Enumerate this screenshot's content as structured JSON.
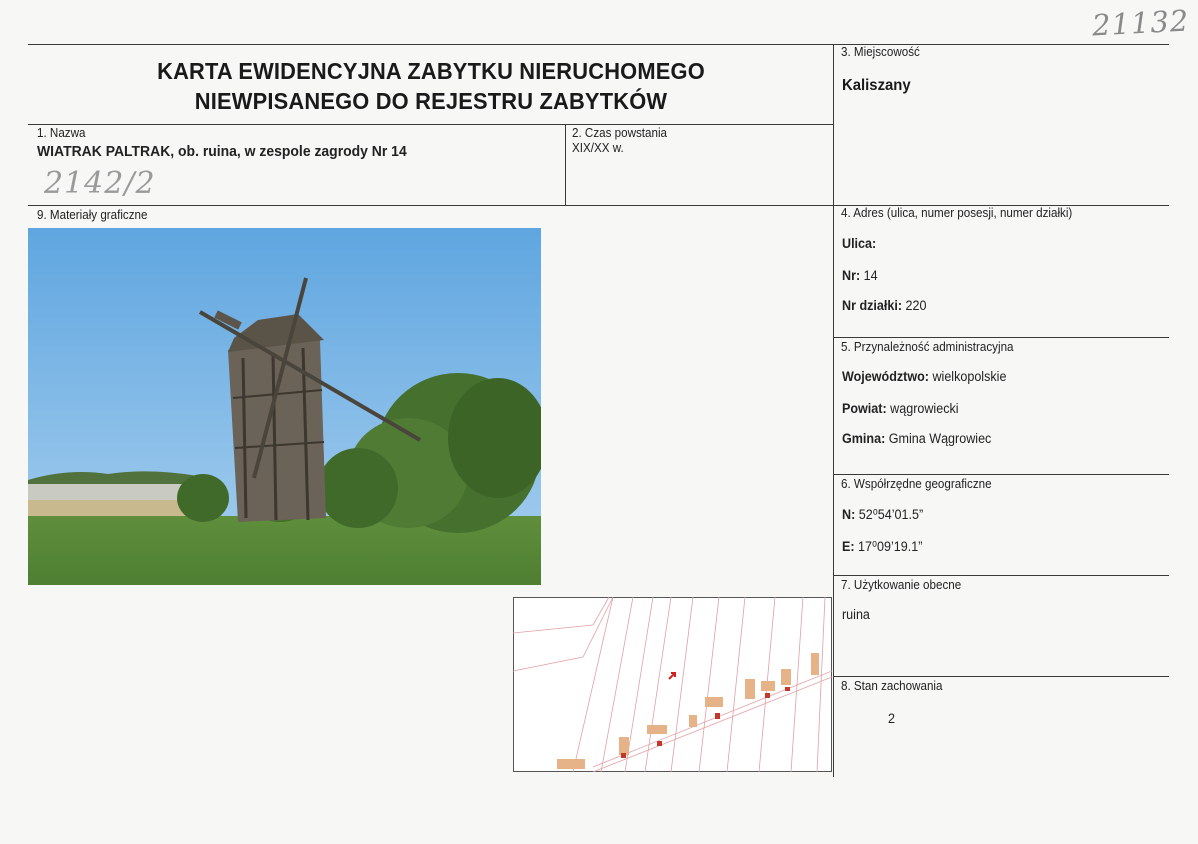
{
  "header": {
    "title_line1": "KARTA EWIDENCYJNA ZABYTKU NIERUCHOMEGO",
    "title_line2": "NIEWPISANEGO DO REJESTRU ZABYTKÓW"
  },
  "handwritten": {
    "top_right": "21132",
    "under_name": "2142/2"
  },
  "fields": {
    "locality": {
      "label": "3. Miejscowość",
      "value": "Kaliszany"
    },
    "name": {
      "label": "1. Nazwa",
      "value": "WIATRAK PALTRAK, ob. ruina, w zespole zagrody Nr 14"
    },
    "period": {
      "label": "2. Czas powstania",
      "value": "XIX/XX w."
    },
    "graphics": {
      "label": "9. Materiały graficzne"
    },
    "address": {
      "label": "4. Adres (ulica, numer posesji, numer działki)",
      "street_key": "Ulica:",
      "street_value": "",
      "number_key": "Nr:",
      "number_value": "14",
      "plot_key": "Nr działki:",
      "plot_value": "220"
    },
    "admin": {
      "label": "5. Przynależność administracyjna",
      "voiv_key": "Województwo:",
      "voiv_value": "wielkopolskie",
      "county_key": "Powiat:",
      "county_value": "wągrowiecki",
      "commune_key": "Gmina:",
      "commune_value": "Gmina Wągrowiec"
    },
    "coords": {
      "label": "6. Współrzędne geograficzne",
      "n_key": "N:",
      "n_value": "52⁰54’01.5”",
      "e_key": "E:",
      "e_value": "17⁰09’19.1”"
    },
    "usage": {
      "label": "7. Użytkowanie obecne",
      "value": "ruina"
    },
    "condition": {
      "label": "8. Stan zachowania",
      "value": "2"
    }
  }
}
